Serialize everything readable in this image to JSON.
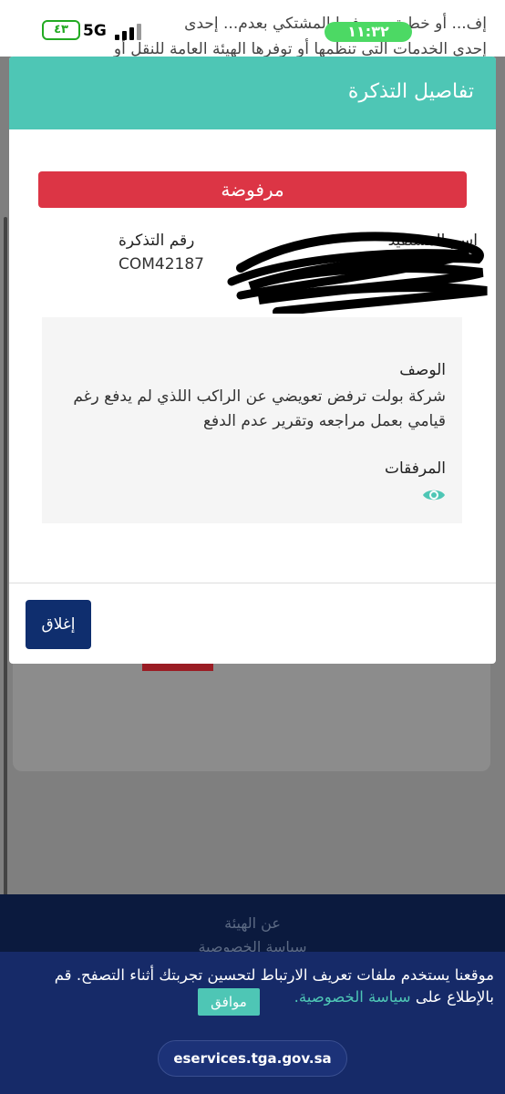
{
  "status_bar": {
    "time": "١١:٣٢",
    "network": "5G",
    "battery": "٤٣"
  },
  "background_page": {
    "line_1": "إف... أو خطية يبين فيها المشتكي بعدم... إحدى",
    "line_2": "إحدى الخدمات التي تنظمها أو توفرها الهيئة العامة للنقل أو"
  },
  "modal": {
    "title": "تفاصيل التذكرة",
    "status_label": "مرفوضة",
    "ticket_number_label": "رقم التذكرة",
    "ticket_number": "COM42187",
    "beneficiary_label": "اسم المستفيد",
    "description_label": "الوصف",
    "description_text": "شركة بولت ترفض تعويضي عن الراكب اللذي لم يدفع رغم قيامي بعمل مراجعه وتقرير عدم الدفع",
    "attachments_label": "المرفقات",
    "close_button": "إغلاق",
    "colors": {
      "header": "#4ec6b5",
      "status": "#dc3545",
      "close": "#0f2e6e"
    }
  },
  "footer": {
    "about_link": "عن الهيئة",
    "privacy_link": "سياسة الخصوصية"
  },
  "cookie_banner": {
    "text": "موقعنا يستخدم ملفات تعريف الارتباط لتحسين تجربتك أثناء التصفح. قم بالإطلاع على",
    "privacy_link": "سياسة الخصوصية.",
    "agree_button": "موافق"
  },
  "browser": {
    "url": "eservices.tga.gov.sa"
  }
}
